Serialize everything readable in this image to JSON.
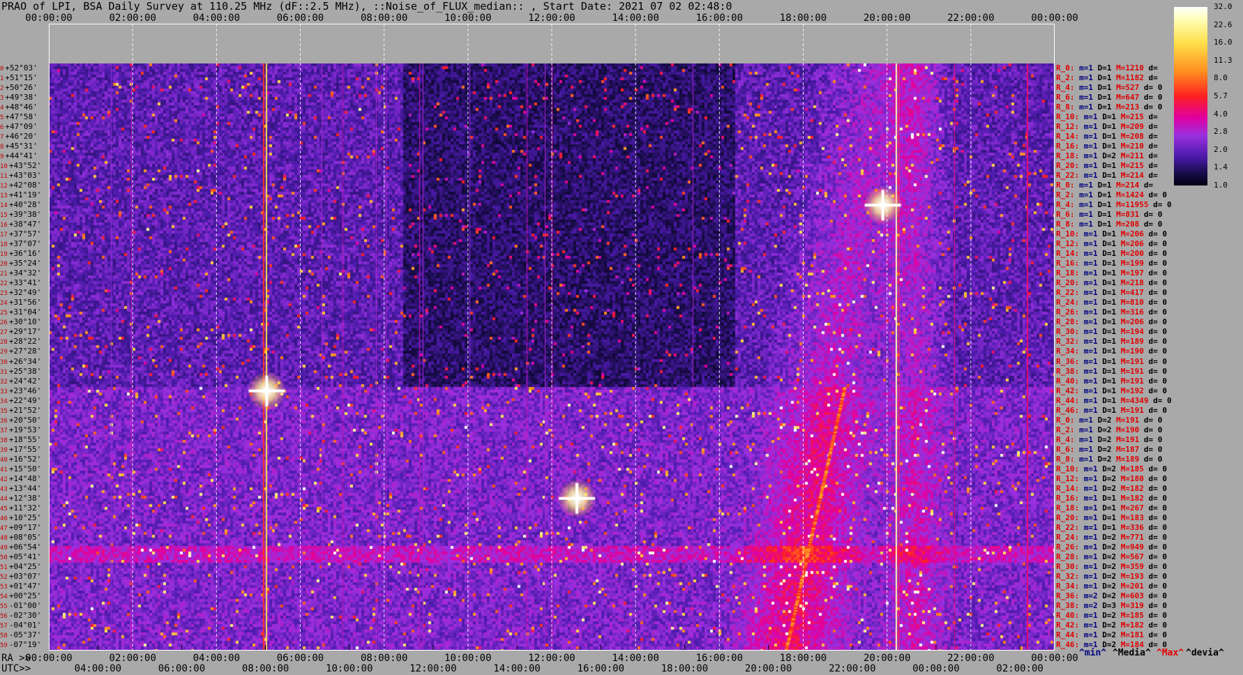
{
  "title": "PRAO of LPI, BSA Daily Survey at 110.25 MHz (dF::2.5 MHz), ::Noise_of_FLUX_median:: , Start Date: 2021 07 02 02:48:0",
  "top_axis_ticks": [
    "00:00:00",
    "02:00:00",
    "04:00:00",
    "06:00:00",
    "08:00:00",
    "10:00:00",
    "12:00:00",
    "14:00:00",
    "16:00:00",
    "18:00:00",
    "20:00:00",
    "22:00:00",
    "00:00:00"
  ],
  "ra_label": "RA >>",
  "ra_ticks": [
    "00:00:00",
    "02:00:00",
    "04:00:00",
    "06:00:00",
    "08:00:00",
    "10:00:00",
    "12:00:00",
    "14:00:00",
    "16:00:00",
    "18:00:00",
    "20:00:00",
    "22:00:00",
    "00:00:00"
  ],
  "utc_label": "UTC>>",
  "utc_ticks": [
    "04:00:00",
    "06:00:00",
    "08:00:00",
    "10:00:00",
    "12:00:00",
    "14:00:00",
    "16:00:00",
    "18:00:00",
    "20:00:00",
    "22:00:00",
    "00:00:00",
    "02:00:00"
  ],
  "colorbar_ticks": [
    "32.0",
    "22.6",
    "16.0",
    "11.3",
    "8.0",
    "5.7",
    "4.0",
    "2.8",
    "2.0",
    "1.4",
    "1.0"
  ],
  "footer_legend": {
    "min": "^min^",
    "median": "^Media^",
    "max": "^Max^",
    "devia": "^devia^"
  },
  "colors": {
    "background": "#a9a9a9",
    "label_red": "#e00000",
    "label_blue": "#000080"
  },
  "chart_data": {
    "type": "heatmap",
    "title": "PRAO of LPI, BSA Daily Survey at 110.25 MHz (dF::2.5 MHz), ::Noise_of_FLUX_median:: , Start Date: 2021 07 02 02:48:0",
    "xlabel": "RA",
    "x_range_hours": [
      0,
      24
    ],
    "colorscale_range": [
      1.0,
      32.0
    ],
    "colorscale": "log",
    "declinations": [
      "+52°03'",
      "+51°15'",
      "+50°26'",
      "+49°38'",
      "+48°46'",
      "+47°58'",
      "+47°09'",
      "+46°20'",
      "+45°31'",
      "+44°41'",
      "+43°52'",
      "+43°03'",
      "+42°08'",
      "+41°19'",
      "+40°28'",
      "+39°38'",
      "+38°47'",
      "+37°57'",
      "+37°07'",
      "+36°16'",
      "+35°24'",
      "+34°32'",
      "+33°41'",
      "+32°49'",
      "+31°56'",
      "+31°04'",
      "+30°10'",
      "+29°17'",
      "+28°22'",
      "+27°28'",
      "+26°34'",
      "+25°38'",
      "+24°42'",
      "+23°46'",
      "+22°49'",
      "+21°52'",
      "+20°50'",
      "+19°53'",
      "+18°55'",
      "+17°55'",
      "+16°52'",
      "+15°50'",
      "+14°48'",
      "+13°44'",
      "+12°38'",
      "+11°32'",
      "+10°25'",
      "+09°17'",
      "+08°05'",
      "+06°54'",
      "+05°41'",
      "+04°25'",
      "+03°07'",
      "+01°47'",
      "+00°25'",
      "-01°00'",
      "-02°30'",
      "-04°01'",
      "-05°37'",
      "-07°19'"
    ],
    "row_indices": [
      "0",
      "1",
      "2",
      "3",
      "4",
      "5",
      "6",
      "7",
      "8",
      "9",
      "10",
      "11",
      "12",
      "13",
      "14",
      "15",
      "16",
      "17",
      "18",
      "19",
      "20",
      "21",
      "22",
      "23",
      "24",
      "25",
      "26",
      "27",
      "28",
      "29",
      "30",
      "31",
      "32",
      "33",
      "34",
      "35",
      "36",
      "37",
      "38",
      "39",
      "40",
      "41",
      "42",
      "43",
      "44",
      "45",
      "46",
      "47",
      "48",
      "49",
      "50",
      "51",
      "52",
      "53",
      "54",
      "55",
      "56",
      "57",
      "58",
      "59"
    ],
    "bright_sources": [
      {
        "ra_hours": 5.2,
        "dec": "+23°46'"
      },
      {
        "ra_hours": 19.9,
        "dec": "+40°28'"
      },
      {
        "ra_hours": 12.6,
        "dec": "+12°38'"
      }
    ],
    "right_labels": [
      {
        "r": "R_0:",
        "m": "m=1",
        "d": "D=1",
        "M": "M=1210",
        "dev": "d="
      },
      {
        "r": "R_2:",
        "m": "m=1",
        "d": "D=1",
        "M": "M=1182",
        "dev": "d="
      },
      {
        "r": "R_4:",
        "m": "m=1",
        "d": "D=1",
        "M": "M=527",
        "dev": "d= 0"
      },
      {
        "r": "R_6:",
        "m": "m=1",
        "d": "D=1",
        "M": "M=647",
        "dev": "d= 0"
      },
      {
        "r": "R_8:",
        "m": "m=1",
        "d": "D=1",
        "M": "M=213",
        "dev": "d= 0"
      },
      {
        "r": "R_10:",
        "m": "m=1",
        "d": "D=1",
        "M": "M=215",
        "dev": "d="
      },
      {
        "r": "R_12:",
        "m": "m=1",
        "d": "D=1",
        "M": "M=209",
        "dev": "d="
      },
      {
        "r": "R_14:",
        "m": "m=1",
        "d": "D=1",
        "M": "M=208",
        "dev": "d="
      },
      {
        "r": "R_16:",
        "m": "m=1",
        "d": "D=1",
        "M": "M=210",
        "dev": "d="
      },
      {
        "r": "R_18:",
        "m": "m=1",
        "d": "D=2",
        "M": "M=211",
        "dev": "d="
      },
      {
        "r": "R_20:",
        "m": "m=1",
        "d": "D=1",
        "M": "M=215",
        "dev": "d="
      },
      {
        "r": "R_22:",
        "m": "m=1",
        "d": "D=1",
        "M": "M=214",
        "dev": "d="
      },
      {
        "r": "R_0:",
        "m": "m=1",
        "d": "D=1",
        "M": "M=214",
        "dev": "d="
      },
      {
        "r": "R_2:",
        "m": "m=1",
        "d": "D=1",
        "M": "M=1424",
        "dev": "d= 0"
      },
      {
        "r": "R_4:",
        "m": "m=1",
        "d": "D=1",
        "M": "M=11955",
        "dev": "d= 0"
      },
      {
        "r": "R_6:",
        "m": "m=1",
        "d": "D=1",
        "M": "M=831",
        "dev": "d= 0"
      },
      {
        "r": "R_8:",
        "m": "m=1",
        "d": "D=1",
        "M": "M=208",
        "dev": "d= 0"
      },
      {
        "r": "R_10:",
        "m": "m=1",
        "d": "D=1",
        "M": "M=206",
        "dev": "d= 0"
      },
      {
        "r": "R_12:",
        "m": "m=1",
        "d": "D=1",
        "M": "M=206",
        "dev": "d= 0"
      },
      {
        "r": "R_14:",
        "m": "m=1",
        "d": "D=1",
        "M": "M=200",
        "dev": "d= 0"
      },
      {
        "r": "R_16:",
        "m": "m=1",
        "d": "D=1",
        "M": "M=199",
        "dev": "d= 0"
      },
      {
        "r": "R_18:",
        "m": "m=1",
        "d": "D=1",
        "M": "M=197",
        "dev": "d= 0"
      },
      {
        "r": "R_20:",
        "m": "m=1",
        "d": "D=1",
        "M": "M=218",
        "dev": "d= 0"
      },
      {
        "r": "R_22:",
        "m": "m=1",
        "d": "D=1",
        "M": "M=417",
        "dev": "d= 0"
      },
      {
        "r": "R_24:",
        "m": "m=1",
        "d": "D=1",
        "M": "M=810",
        "dev": "d= 0"
      },
      {
        "r": "R_26:",
        "m": "m=1",
        "d": "D=1",
        "M": "M=316",
        "dev": "d= 0"
      },
      {
        "r": "R_28:",
        "m": "m=1",
        "d": "D=1",
        "M": "M=206",
        "dev": "d= 0"
      },
      {
        "r": "R_30:",
        "m": "m=1",
        "d": "D=1",
        "M": "M=194",
        "dev": "d= 0"
      },
      {
        "r": "R_32:",
        "m": "m=1",
        "d": "D=1",
        "M": "M=189",
        "dev": "d= 0"
      },
      {
        "r": "R_34:",
        "m": "m=1",
        "d": "D=1",
        "M": "M=190",
        "dev": "d= 0"
      },
      {
        "r": "R_36:",
        "m": "m=1",
        "d": "D=1",
        "M": "M=191",
        "dev": "d= 0"
      },
      {
        "r": "R_38:",
        "m": "m=1",
        "d": "D=1",
        "M": "M=191",
        "dev": "d= 0"
      },
      {
        "r": "R_40:",
        "m": "m=1",
        "d": "D=1",
        "M": "M=191",
        "dev": "d= 0"
      },
      {
        "r": "R_42:",
        "m": "m=1",
        "d": "D=1",
        "M": "M=192",
        "dev": "d= 0"
      },
      {
        "r": "R_44:",
        "m": "m=1",
        "d": "D=1",
        "M": "M=4349",
        "dev": "d= 0"
      },
      {
        "r": "R_46:",
        "m": "m=1",
        "d": "D=1",
        "M": "M=191",
        "dev": "d= 0"
      },
      {
        "r": "R_0:",
        "m": "m=1",
        "d": "D=2",
        "M": "M=191",
        "dev": "d= 0"
      },
      {
        "r": "R_2:",
        "m": "m=1",
        "d": "D=2",
        "M": "M=190",
        "dev": "d= 0"
      },
      {
        "r": "R_4:",
        "m": "m=1",
        "d": "D=2",
        "M": "M=191",
        "dev": "d= 0"
      },
      {
        "r": "R_6:",
        "m": "m=1",
        "d": "D=2",
        "M": "M=187",
        "dev": "d= 0"
      },
      {
        "r": "R_8:",
        "m": "m=1",
        "d": "D=2",
        "M": "M=189",
        "dev": "d= 0"
      },
      {
        "r": "R_10:",
        "m": "m=1",
        "d": "D=2",
        "M": "M=185",
        "dev": "d= 0"
      },
      {
        "r": "R_12:",
        "m": "m=1",
        "d": "D=2",
        "M": "M=180",
        "dev": "d= 0"
      },
      {
        "r": "R_14:",
        "m": "m=1",
        "d": "D=2",
        "M": "M=182",
        "dev": "d= 0"
      },
      {
        "r": "R_16:",
        "m": "m=1",
        "d": "D=1",
        "M": "M=182",
        "dev": "d= 0"
      },
      {
        "r": "R_18:",
        "m": "m=1",
        "d": "D=1",
        "M": "M=267",
        "dev": "d= 0"
      },
      {
        "r": "R_20:",
        "m": "m=1",
        "d": "D=1",
        "M": "M=183",
        "dev": "d= 0"
      },
      {
        "r": "R_22:",
        "m": "m=1",
        "d": "D=1",
        "M": "M=336",
        "dev": "d= 0"
      },
      {
        "r": "R_24:",
        "m": "m=1",
        "d": "D=2",
        "M": "M=771",
        "dev": "d= 0"
      },
      {
        "r": "R_26:",
        "m": "m=1",
        "d": "D=2",
        "M": "M=949",
        "dev": "d= 0"
      },
      {
        "r": "R_28:",
        "m": "m=1",
        "d": "D=2",
        "M": "M=567",
        "dev": "d= 0"
      },
      {
        "r": "R_30:",
        "m": "m=1",
        "d": "D=2",
        "M": "M=359",
        "dev": "d= 0"
      },
      {
        "r": "R_32:",
        "m": "m=1",
        "d": "D=2",
        "M": "M=193",
        "dev": "d= 0"
      },
      {
        "r": "R_34:",
        "m": "m=1",
        "d": "D=2",
        "M": "M=201",
        "dev": "d= 0"
      },
      {
        "r": "R_36:",
        "m": "m=2",
        "d": "D=2",
        "M": "M=603",
        "dev": "d= 0"
      },
      {
        "r": "R_38:",
        "m": "m=2",
        "d": "D=3",
        "M": "M=319",
        "dev": "d= 0"
      },
      {
        "r": "R_40:",
        "m": "m=1",
        "d": "D=2",
        "M": "M=185",
        "dev": "d= 0"
      },
      {
        "r": "R_42:",
        "m": "m=1",
        "d": "D=2",
        "M": "M=182",
        "dev": "d= 0"
      },
      {
        "r": "R_44:",
        "m": "m=1",
        "d": "D=2",
        "M": "M=181",
        "dev": "d= 0"
      },
      {
        "r": "R_46:",
        "m": "m=1",
        "d": "D=2",
        "M": "M=184",
        "dev": "d= 0"
      }
    ]
  }
}
